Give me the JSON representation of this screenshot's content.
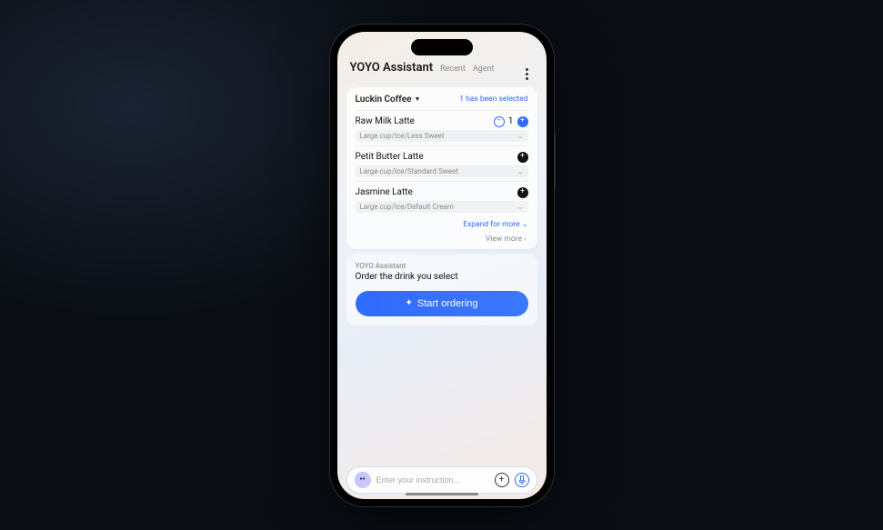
{
  "header": {
    "title": "YOYO Assistant",
    "tabs": [
      "Recent",
      "Agent"
    ]
  },
  "order_card": {
    "store": "Luckin Coffee",
    "selected_text": "1 has been selected",
    "items": [
      {
        "name": "Raw Milk Latte",
        "options": "Large cup/Ice/Less Sweet",
        "qty": 1,
        "has_qty": true
      },
      {
        "name": "Petit Butter Latte",
        "options": "Large cup/Ice/Standard Sweet",
        "qty": 0,
        "has_qty": false
      },
      {
        "name": "Jasmine Latte",
        "options": "Large cup/Ice/Default Cream",
        "qty": 0,
        "has_qty": false
      }
    ],
    "expand_label": "Expand for more",
    "view_more_label": "View more"
  },
  "assistant": {
    "label": "YOYO Assistant",
    "message": "Order the drink you select",
    "button": "Start ordering"
  },
  "input": {
    "placeholder": "Enter your instruction..."
  }
}
